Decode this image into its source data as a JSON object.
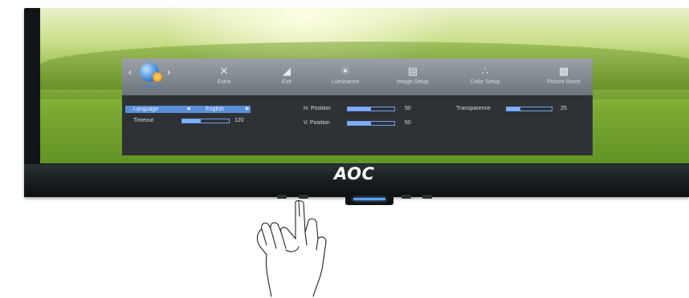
{
  "monitor": {
    "brand_logo": "AOC",
    "led_color": "#5aa4e8"
  },
  "osd": {
    "active_tab": {
      "label": "Language",
      "icon": "globe-gear-icon",
      "accent": "#3f7fd0"
    },
    "tabs": [
      {
        "label": "Extra",
        "icon": "tools-icon"
      },
      {
        "label": "Exit",
        "icon": "exit-door-icon"
      },
      {
        "label": "Luminance",
        "icon": "sun-icon"
      },
      {
        "label": "Image Setup",
        "icon": "image-setup-icon"
      },
      {
        "label": "Color Setup",
        "icon": "color-dots-icon"
      },
      {
        "label": "Picture Boost",
        "icon": "picture-boost-icon"
      }
    ],
    "settings": {
      "language": {
        "label": "Language",
        "value": "English"
      },
      "timeout": {
        "label": "Timeout",
        "value": "120",
        "level": 0.4
      },
      "h_position": {
        "label": "H. Position",
        "value": "50",
        "level": 0.5
      },
      "v_position": {
        "label": "V. Position",
        "value": "50",
        "level": 0.5
      },
      "transparence": {
        "label": "Transparence",
        "value": "25",
        "level": 0.3
      }
    },
    "colors": {
      "panel": "#2e3236",
      "tab_bar": "#9aa2a8",
      "highlight": "#5a8fd8",
      "bar_fill": "#7fb0ff"
    }
  }
}
